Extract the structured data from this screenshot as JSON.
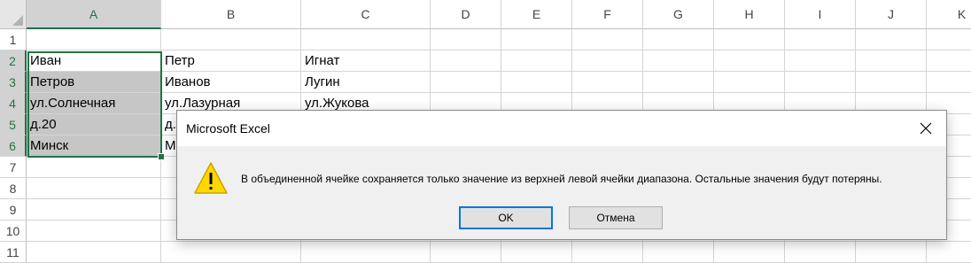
{
  "columns": [
    "A",
    "B",
    "C",
    "D",
    "E",
    "F",
    "G",
    "H",
    "I",
    "J",
    "K"
  ],
  "rows": [
    "1",
    "2",
    "3",
    "4",
    "5",
    "6",
    "7",
    "8",
    "9",
    "10",
    "11"
  ],
  "cells": {
    "A2": "Иван",
    "B2": "Петр",
    "C2": "Игнат",
    "A3": "Петров",
    "B3": "Иванов",
    "C3": "Лугин",
    "A4": "ул.Солнечная",
    "B4": "ул.Лазурная",
    "C4": "ул.Жукова",
    "A5": "д.20",
    "B5": "д.",
    "A6": "Минск",
    "B6": "М"
  },
  "selection": {
    "range": "A2:A6",
    "color": "#217346"
  },
  "dialog": {
    "title": "Microsoft Excel",
    "close_icon": "close-icon",
    "warning_icon": "warning-icon",
    "message": "В объединенной ячейке сохраняется только значение из верхней левой ячейки диапазона. Остальные значения будут потеряны.",
    "ok_label": "OK",
    "cancel_label": "Отмена",
    "ok_border_color": "#0078d7"
  }
}
